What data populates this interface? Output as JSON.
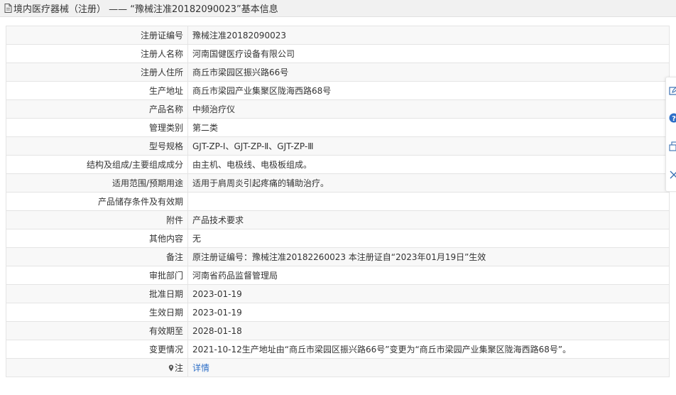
{
  "header": {
    "title": "境内医疗器械（注册） —— “豫械注准20182090023”基本信息",
    "icon": "document-icon"
  },
  "rows": [
    {
      "label": "注册证编号",
      "value": "豫械注准20182090023"
    },
    {
      "label": "注册人名称",
      "value": "河南国健医疗设备有限公司"
    },
    {
      "label": "注册人住所",
      "value": "商丘市梁园区振兴路66号"
    },
    {
      "label": "生产地址",
      "value": "商丘市梁园产业集聚区陇海西路68号"
    },
    {
      "label": "产品名称",
      "value": "中频治疗仪"
    },
    {
      "label": "管理类别",
      "value": "第二类"
    },
    {
      "label": "型号规格",
      "value": "GJT-ZP-Ⅰ、GJT-ZP-Ⅱ、GJT-ZP-Ⅲ"
    },
    {
      "label": "结构及组成/主要组成成分",
      "value": "由主机、电极线、电极板组成。"
    },
    {
      "label": "适用范围/预期用途",
      "value": "适用于肩周炎引起疼痛的辅助治疗。"
    },
    {
      "label": "产品储存条件及有效期",
      "value": ""
    },
    {
      "label": "附件",
      "value": "产品技术要求"
    },
    {
      "label": "其他内容",
      "value": "无"
    },
    {
      "label": "备注",
      "value": "原注册证编号：豫械注准20182260023 本注册证自“2023年01月19日”生效"
    },
    {
      "label": "审批部门",
      "value": "河南省药品监督管理局"
    },
    {
      "label": "批准日期",
      "value": "2023-01-19"
    },
    {
      "label": "生效日期",
      "value": "2023-01-19"
    },
    {
      "label": "有效期至",
      "value": "2028-01-18"
    },
    {
      "label": "变更情况",
      "value": "2021-10-12生产地址由“商丘市梁园区振兴路66号”变更为“商丘市梁园产业集聚区陇海西路68号”。"
    }
  ],
  "note_row": {
    "label": "注",
    "link": "详情",
    "icon": "location-pin-icon"
  },
  "side_toolbar": [
    "edit-icon",
    "help-icon",
    "copy-icon",
    "close-icon"
  ],
  "colors": {
    "link": "#2e6fc7",
    "border": "#e4e4e4",
    "header_bg": "#f1f1f1"
  }
}
